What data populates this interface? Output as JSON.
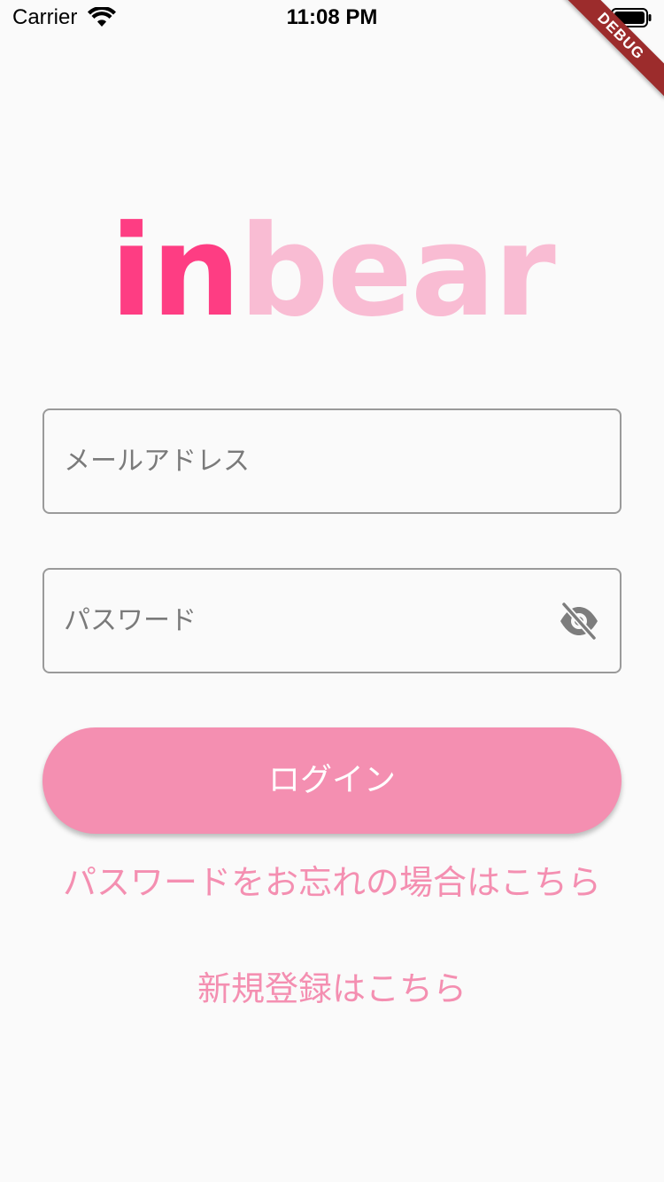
{
  "status_bar": {
    "carrier": "Carrier",
    "time": "11:08 PM",
    "wifi_icon": "wifi-icon",
    "battery_icon": "battery-icon"
  },
  "debug_banner": "DEBUG",
  "logo": {
    "part1": "in",
    "part2": "bear",
    "colors": {
      "part1": "#fe3d83",
      "part2": "#f9bcd3"
    }
  },
  "form": {
    "email_placeholder": "メールアドレス",
    "password_placeholder": "パスワード",
    "password_toggle_icon": "eye-off-icon"
  },
  "buttons": {
    "login_label": "ログイン"
  },
  "links": {
    "forgot_password": "パスワードをお忘れの場合はこちら",
    "register": "新規登録はこちら"
  },
  "colors": {
    "accent": "#f48fb1",
    "background": "#fafafa",
    "field_border": "#9a9a9a"
  }
}
